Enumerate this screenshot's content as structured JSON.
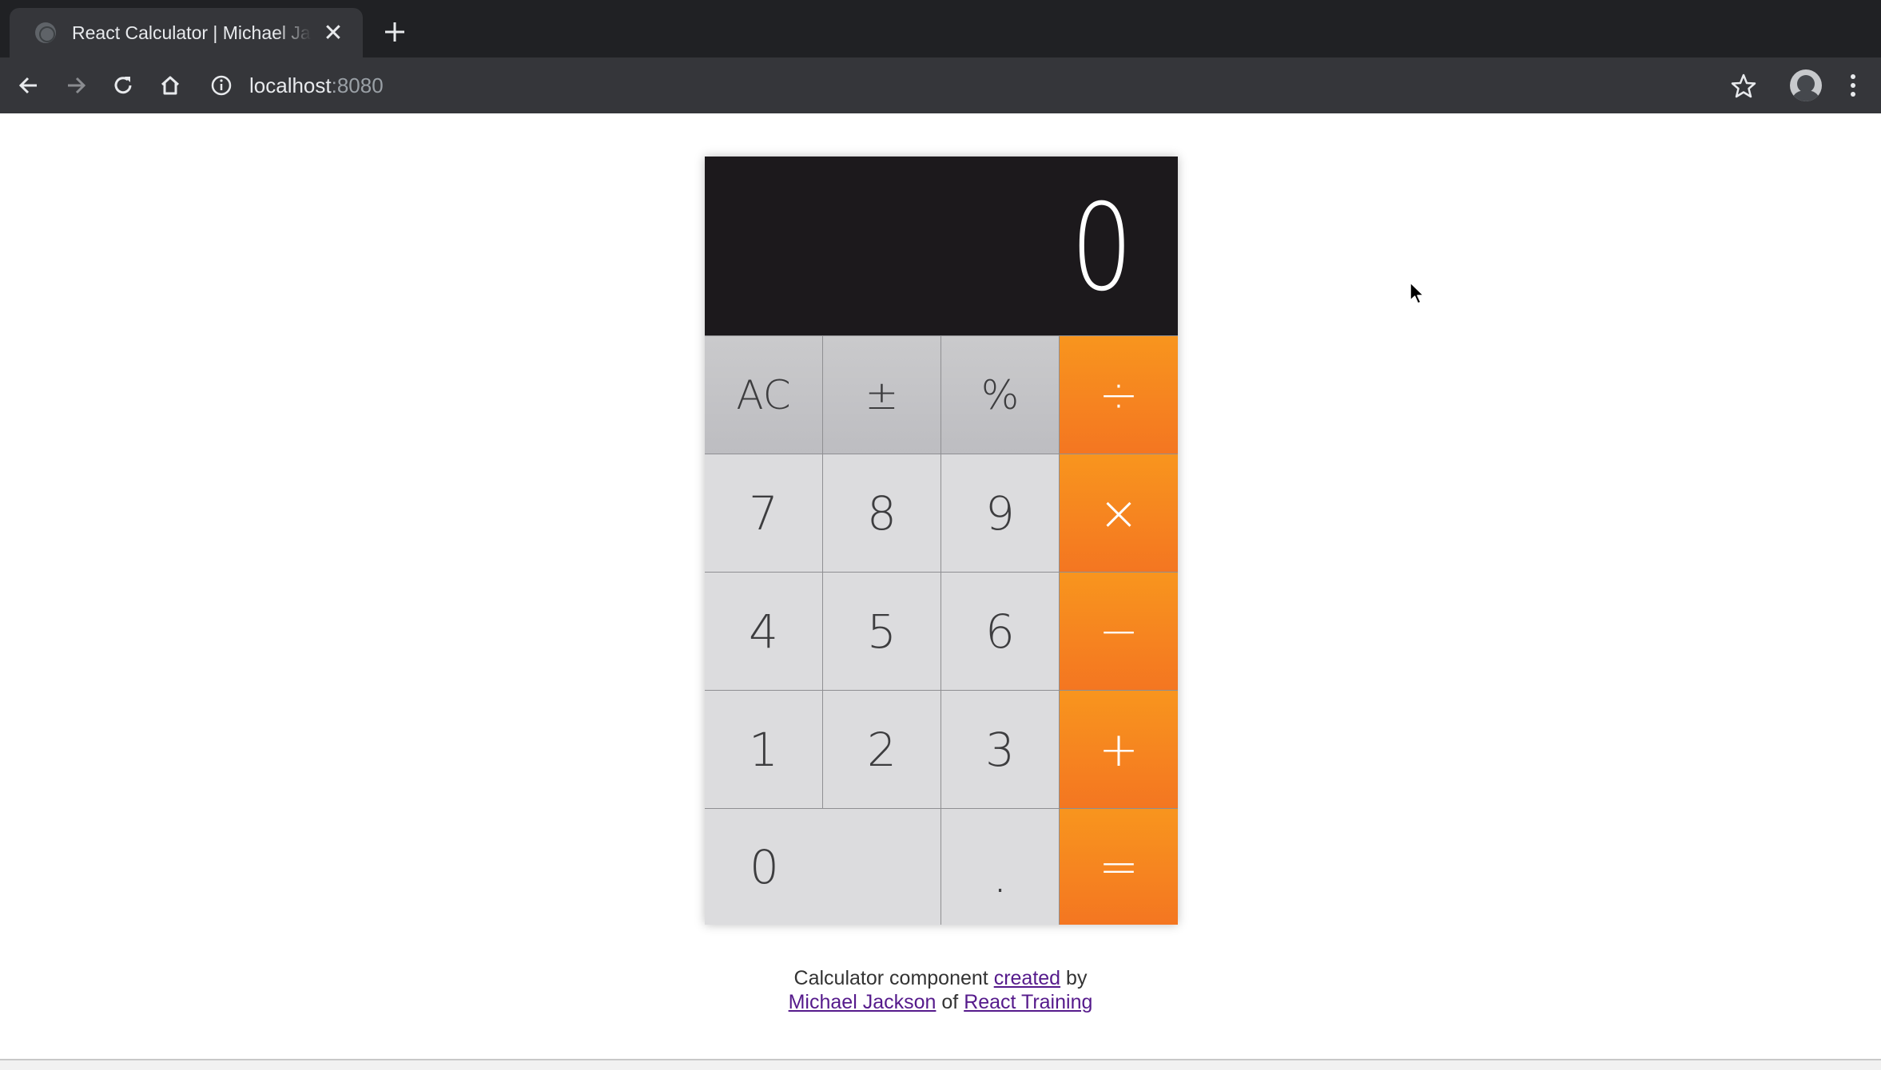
{
  "browser": {
    "tab_title": "React Calculator | Michael Jackson",
    "tab_close_icon": "close-icon",
    "new_tab_icon": "plus-icon",
    "url_host": "localhost",
    "url_port": ":8080",
    "icons": [
      "back-arrow-icon",
      "forward-arrow-icon",
      "reload-icon",
      "home-icon",
      "info-icon",
      "star-icon",
      "avatar",
      "menu-dots-icon"
    ]
  },
  "calculator": {
    "display_value": "0",
    "keys": {
      "clear": "AC",
      "sign": "±",
      "percent": "%",
      "divide": "÷",
      "multiply": "×",
      "subtract": "−",
      "add": "+",
      "equals": "=",
      "seven": "7",
      "eight": "8",
      "nine": "9",
      "four": "4",
      "five": "5",
      "six": "6",
      "one": "1",
      "two": "2",
      "three": "3",
      "zero": "0",
      "dot": "."
    },
    "colors": {
      "display_bg": "#1c191c",
      "operator": "#f58a1f",
      "function_key": "#c4c4c7",
      "digit_key": "#dcdcde"
    }
  },
  "footer": {
    "text1": "Calculator component",
    "link_created": "created",
    "text2": "by",
    "link_author": "Michael Jackson",
    "text3": "of",
    "link_org": "React Training"
  }
}
